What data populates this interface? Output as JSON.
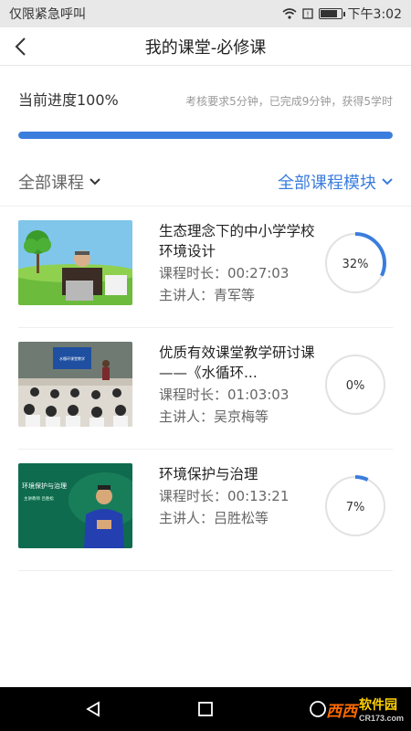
{
  "status_bar": {
    "carrier": "仅限紧急呼叫",
    "time": "下午3:02",
    "battery_level": 0.9
  },
  "header": {
    "title": "我的课堂-必修课",
    "back_icon": "chevron-left-icon"
  },
  "progress": {
    "label": "当前进度100%",
    "percent": 100,
    "detail": "考核要求5分钟，已完成9分钟，获得5学时",
    "color": "#3b7ddd"
  },
  "filters": {
    "left_label": "全部课程",
    "right_label": "全部课程模块"
  },
  "courses": [
    {
      "title": "生态理念下的中小学学校环境设计",
      "duration_label": "课程时长：",
      "duration": "00:27:03",
      "speaker_label": "主讲人：",
      "speaker": "青军等",
      "progress_text": "32%",
      "progress": 0.32
    },
    {
      "title": "优质有效课堂教学研讨课——《水循环...",
      "duration_label": "课程时长：",
      "duration": "01:03:03",
      "speaker_label": "主讲人：",
      "speaker": "吴京梅等",
      "progress_text": "0%",
      "progress": 0
    },
    {
      "title": " 环境保护与治理",
      "duration_label": "课程时长：",
      "duration": "00:13:21",
      "speaker_label": "主讲人：",
      "speaker": "吕胜松等",
      "progress_text": "7%",
      "progress": 0.07
    }
  ],
  "thumb_texts": {
    "c2_board": "水循环课堂教学",
    "c3_board": "环境保护与治理",
    "c3_sub": "主讲教师  吕胜松"
  },
  "watermark": {
    "brand": "西西",
    "name": "软件园",
    "url": "CR173.com"
  }
}
